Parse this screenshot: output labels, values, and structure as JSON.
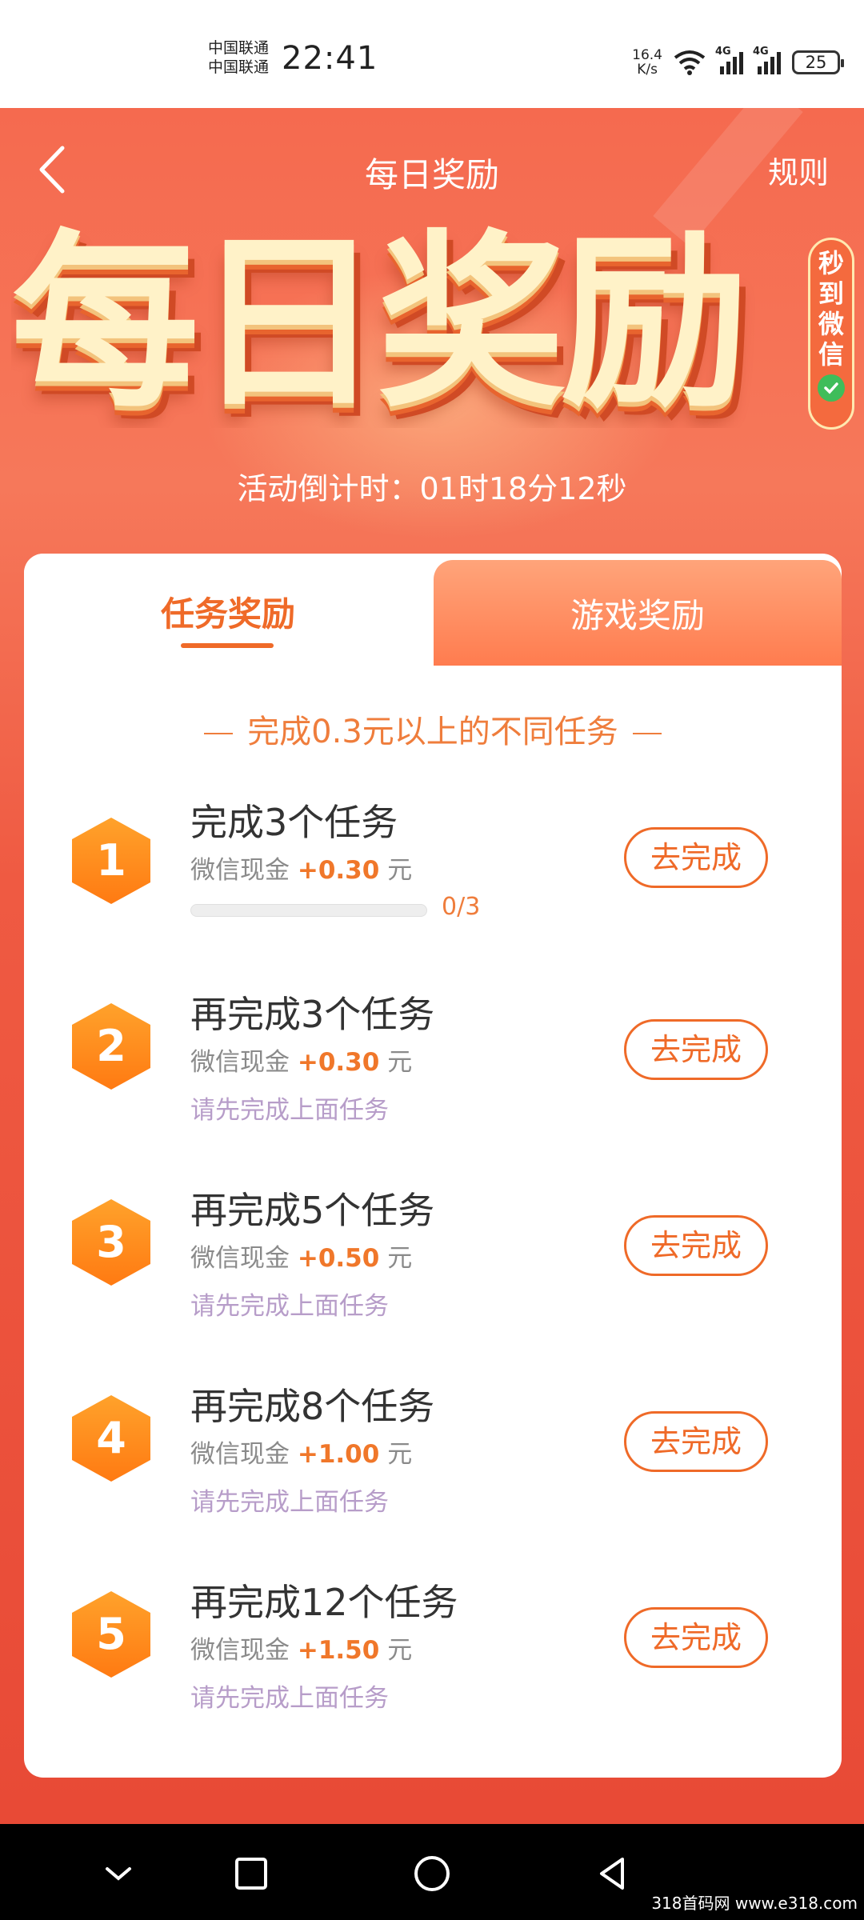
{
  "status_bar": {
    "carrier_1": "中国联通",
    "carrier_2": "中国联通",
    "time": "22:41",
    "net_speed_value": "16.4",
    "net_speed_unit": "K/s",
    "signal_1": "4G",
    "signal_2": "4G",
    "battery": "25"
  },
  "navbar": {
    "title": "每日奖励",
    "rules": "规则"
  },
  "banner": {
    "headline": "每日奖励",
    "badge_chars": [
      "秒",
      "到",
      "微",
      "信"
    ],
    "countdown_label": "活动倒计时：",
    "countdown_value": "01时18分12秒"
  },
  "tabs": [
    {
      "label": "任务奖励",
      "active": true
    },
    {
      "label": "游戏奖励",
      "active": false
    }
  ],
  "section_subtitle": "完成0.3元以上的不同任务",
  "tasks": [
    {
      "number": "1",
      "title": "完成3个任务",
      "reward_prefix": "微信现金",
      "amount": "+0.30",
      "unit": "元",
      "progress_text": "0/3",
      "progress": 0.0,
      "button": "去完成"
    },
    {
      "number": "2",
      "title": "再完成3个任务",
      "reward_prefix": "微信现金",
      "amount": "+0.30",
      "unit": "元",
      "hint": "请先完成上面任务",
      "button": "去完成"
    },
    {
      "number": "3",
      "title": "再完成5个任务",
      "reward_prefix": "微信现金",
      "amount": "+0.50",
      "unit": "元",
      "hint": "请先完成上面任务",
      "button": "去完成"
    },
    {
      "number": "4",
      "title": "再完成8个任务",
      "reward_prefix": "微信现金",
      "amount": "+1.00",
      "unit": "元",
      "hint": "请先完成上面任务",
      "button": "去完成"
    },
    {
      "number": "5",
      "title": "再完成12个任务",
      "reward_prefix": "微信现金",
      "amount": "+1.50",
      "unit": "元",
      "hint": "请先完成上面任务",
      "button": "去完成"
    }
  ],
  "watermark": "318首码网 www.e318.com",
  "colors": {
    "accent": "#ef6a28",
    "background_red": "#ef5a42",
    "hint": "#b79dc9"
  }
}
